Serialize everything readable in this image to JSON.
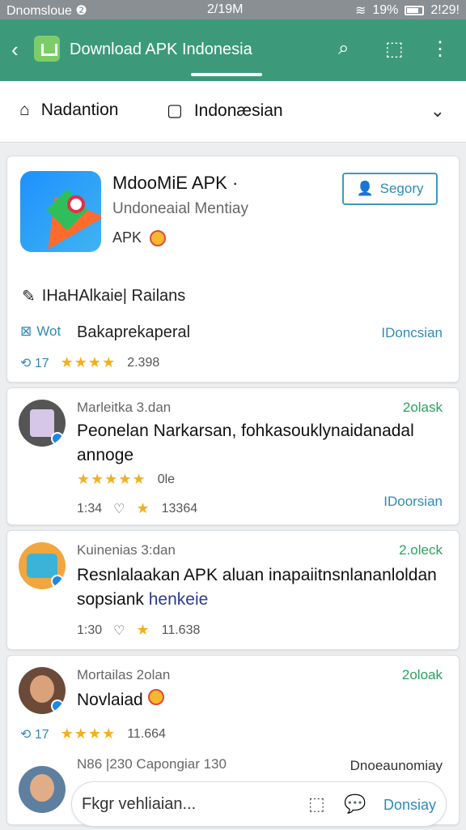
{
  "status_bar": {
    "left": "Dnomsloue ❷",
    "time": "2/19M",
    "right_battery": "19%",
    "right_time": "2!29!"
  },
  "app_bar": {
    "title": "Download APK Indonesia",
    "color": "#3c9a7b"
  },
  "tabs": [
    {
      "label": "Nadantion",
      "icon": "home-icon"
    },
    {
      "label": "Indonæsian",
      "icon": "chat-icon"
    }
  ],
  "app_card": {
    "title": "MdooMiE APK ·",
    "subtitle": "Undoneaial Mentiay",
    "apk_label": "APK",
    "follow_button": "Segory",
    "section_title": "IHaHAlkaie| Railans",
    "meta_tag": "Wot",
    "meta_title": "Bakaprekaperal",
    "meta_lang": "IDoncsian",
    "meta_count": "17",
    "meta_stars": "★★★★",
    "meta_rating": "2.398"
  },
  "reviews": [
    {
      "user": "Marleitka 3.dan",
      "count": "2olask",
      "text": "Peonelan Narkarsan, fohkasouklynaidanadal annoge",
      "stars": "★★★★★",
      "rating_label": "0le",
      "time": "1:34",
      "score": "13364",
      "lang": "IDoorsian"
    },
    {
      "user": "Kuinenias 3:dan",
      "count": "2.oleck",
      "text": "Resnlalaakan APK aluan inapaiitnsnlananloldan sopsiank",
      "text_link": "henkeie",
      "time": "1:30",
      "score": "11.638"
    },
    {
      "user": "Mortailas 2olan",
      "count": "2oloak",
      "text": "Novlaiad",
      "meta_count": "17",
      "stars": "★★★★",
      "score": "11.664"
    }
  ],
  "partial_row": {
    "user": "N86 |230 Capongiar 130",
    "right": "Dnoeaunomiay"
  },
  "composer": {
    "placeholder": "Fkgr vehliaian...",
    "send": "Donsiay"
  }
}
